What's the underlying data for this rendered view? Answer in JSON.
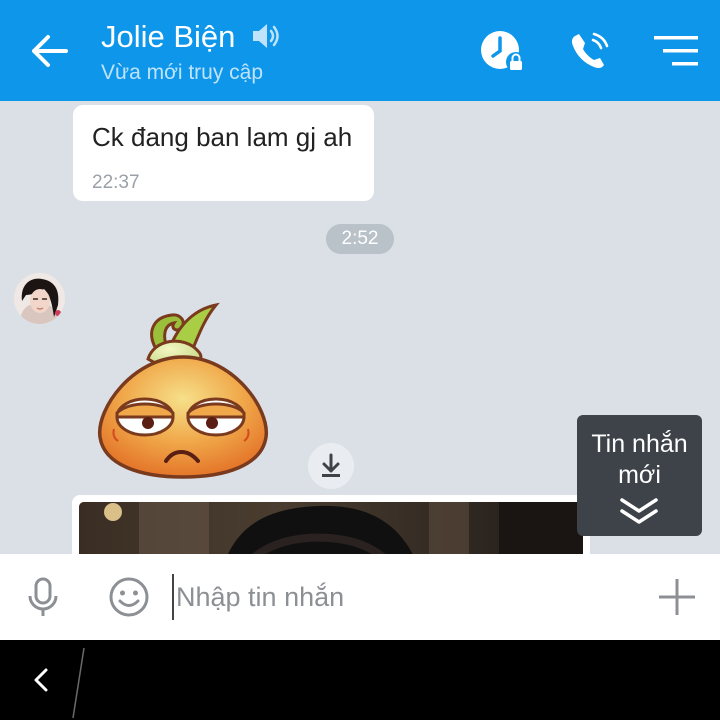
{
  "header": {
    "contact_name": "Jolie Biện",
    "status": "Vừa mới truy cập",
    "icons": [
      "back-arrow-icon",
      "speaker-icon",
      "clock-lock-icon",
      "phone-call-icon",
      "menu-icon"
    ]
  },
  "messages": [
    {
      "type": "text",
      "direction": "outgoing",
      "text": "Ck đang ban lam gj ah",
      "time": "22:37"
    }
  ],
  "time_separator": "2:52",
  "incoming": {
    "sticker": "onion-sticker",
    "photo": "photo-attachment"
  },
  "new_messages_badge": {
    "label": "Tin nhắn mới",
    "icon": "double-chevron-down-icon"
  },
  "composer": {
    "placeholder": "Nhập tin nhắn",
    "value": "",
    "icons": [
      "microphone-icon",
      "emoji-icon",
      "plus-icon"
    ]
  },
  "colors": {
    "header": "#0d96ea",
    "chat_background": "#dbe0e6",
    "badge": "#3d4349"
  }
}
